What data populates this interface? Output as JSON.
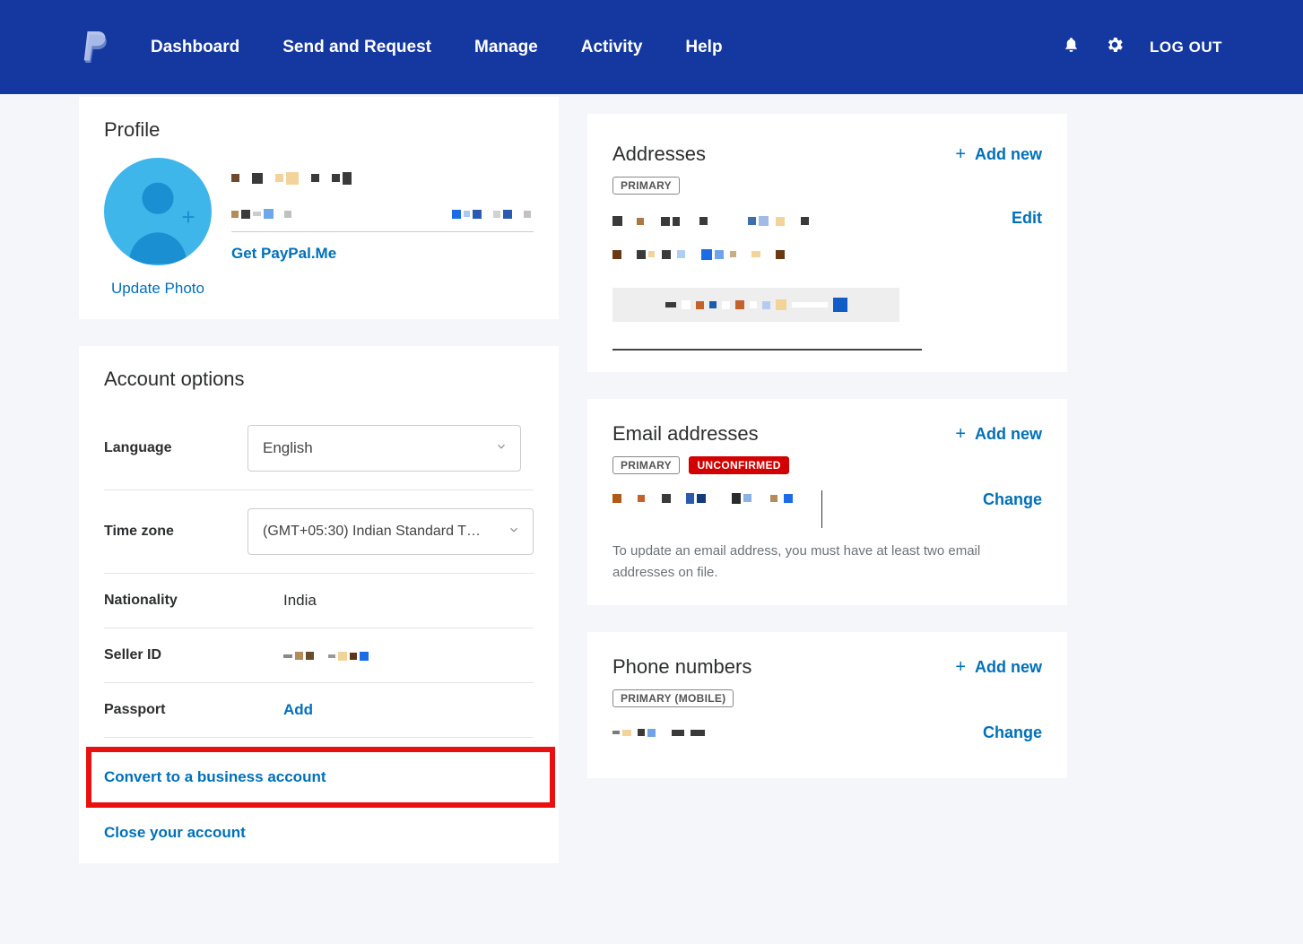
{
  "header": {
    "nav": [
      "Dashboard",
      "Send and Request",
      "Manage",
      "Activity",
      "Help"
    ],
    "logout": "LOG OUT"
  },
  "profile": {
    "title": "Profile",
    "update_photo": "Update Photo",
    "get_paypalme": "Get PayPal.Me"
  },
  "account_options": {
    "title": "Account options",
    "language_label": "Language",
    "language_value": "English",
    "timezone_label": "Time zone",
    "timezone_value": "(GMT+05:30) Indian Standard T…",
    "nationality_label": "Nationality",
    "nationality_value": "India",
    "sellerid_label": "Seller ID",
    "passport_label": "Passport",
    "passport_action": "Add",
    "convert": "Convert to a business account",
    "close": "Close your account"
  },
  "addresses": {
    "title": "Addresses",
    "add": "Add new",
    "primary": "PRIMARY",
    "edit": "Edit"
  },
  "emails": {
    "title": "Email addresses",
    "add": "Add new",
    "primary": "PRIMARY",
    "unconfirmed": "UNCONFIRMED",
    "change": "Change",
    "note": "To update an email address, you must have at least two email addresses on file."
  },
  "phones": {
    "title": "Phone numbers",
    "add": "Add new",
    "primary_mobile": "PRIMARY (MOBILE)",
    "change": "Change"
  }
}
